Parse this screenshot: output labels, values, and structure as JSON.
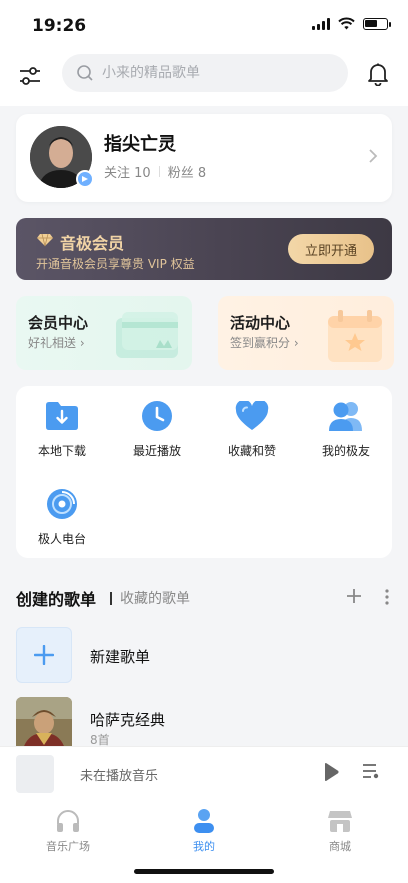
{
  "status_bar": {
    "time": "19:26"
  },
  "search": {
    "placeholder": "小来的精品歌单"
  },
  "profile": {
    "name": "指尖亡灵",
    "following_label": "关注 10",
    "followers_label": "粉丝 8"
  },
  "vip": {
    "title": "音极会员",
    "description": "开通音极会员享尊贵 VIP 权益",
    "button_label": "立即开通"
  },
  "cards": {
    "member": {
      "title": "会员中心",
      "subtitle": "好礼相送 ›"
    },
    "activity": {
      "title": "活动中心",
      "subtitle": "签到赢积分 ›"
    }
  },
  "shortcuts": [
    {
      "label": "本地下载",
      "icon": "download-folder-icon"
    },
    {
      "label": "最近播放",
      "icon": "clock-icon"
    },
    {
      "label": "收藏和赞",
      "icon": "heart-icon"
    },
    {
      "label": "我的极友",
      "icon": "friends-icon"
    },
    {
      "label": "极人电台",
      "icon": "radio-icon"
    }
  ],
  "playlists_section": {
    "created_tab": "创建的歌单",
    "collected_tab": "收藏的歌单"
  },
  "playlists": [
    {
      "name": "新建歌单"
    },
    {
      "name": "哈萨克经典",
      "count": "8首"
    }
  ],
  "player": {
    "text": "未在播放音乐"
  },
  "tabs": [
    {
      "label": "音乐广场",
      "icon": "headphones-icon"
    },
    {
      "label": "我的",
      "icon": "user-icon"
    },
    {
      "label": "商城",
      "icon": "shop-icon"
    }
  ],
  "colors": {
    "accent": "#3d8ff0",
    "vip_gold": "#f1d4a6",
    "background": "#f4f5f7"
  }
}
